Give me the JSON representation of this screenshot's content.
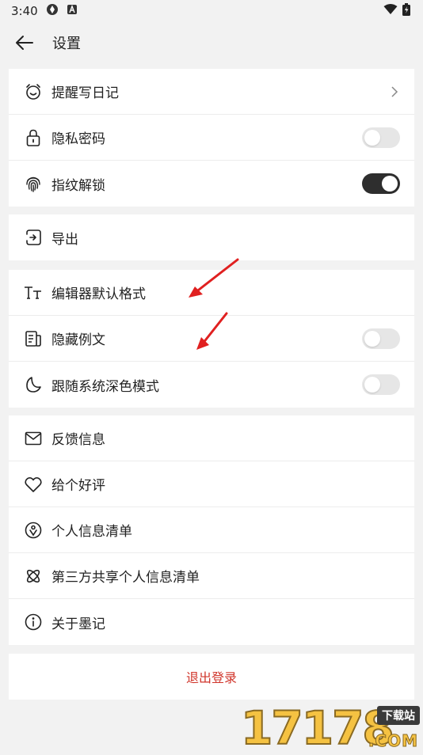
{
  "status": {
    "time": "3:40"
  },
  "appbar": {
    "title": "设置"
  },
  "group1": [
    {
      "label": "提醒写日记",
      "icon": "alarm-clock-icon",
      "trailing": "chevron"
    },
    {
      "label": "隐私密码",
      "icon": "lock-icon",
      "trailing": "toggle",
      "on": false
    },
    {
      "label": "指纹解锁",
      "icon": "fingerprint-icon",
      "trailing": "toggle",
      "on": true
    }
  ],
  "group2": [
    {
      "label": "导出",
      "icon": "export-icon"
    }
  ],
  "group3": [
    {
      "label": "编辑器默认格式",
      "icon": "text-format-icon"
    },
    {
      "label": "隐藏例文",
      "icon": "document-icon",
      "trailing": "toggle",
      "on": false
    },
    {
      "label": "跟随系统深色模式",
      "icon": "moon-icon",
      "trailing": "toggle",
      "on": false
    }
  ],
  "group4": [
    {
      "label": "反馈信息",
      "icon": "mail-icon"
    },
    {
      "label": "给个好评",
      "icon": "heart-icon"
    },
    {
      "label": "个人信息清单",
      "icon": "person-info-icon"
    },
    {
      "label": "第三方共享个人信息清单",
      "icon": "share-icon"
    },
    {
      "label": "关于墨记",
      "icon": "info-icon"
    }
  ],
  "logout": {
    "label": "退出登录"
  },
  "watermark": {
    "digits": "17178",
    "tag": "下载站",
    "domain": ".COM"
  },
  "colors": {
    "accent_red": "#d0352b",
    "toggle_on": "#2e2e2e",
    "toggle_off": "#e6e6e6",
    "annotation_arrow": "#e02020"
  }
}
